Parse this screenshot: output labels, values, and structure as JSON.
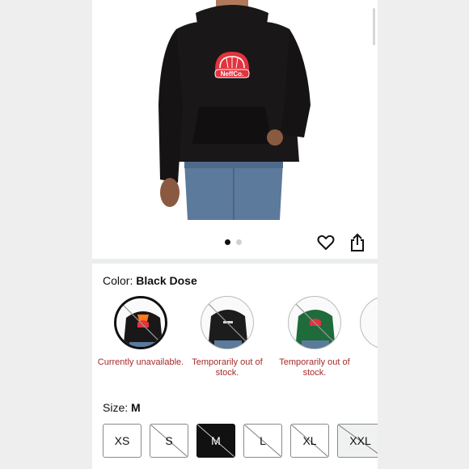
{
  "product": {
    "logo_text": "NeffCo."
  },
  "gallery": {
    "dots": [
      true,
      false
    ]
  },
  "color": {
    "label": "Color:",
    "selected": "Black Dose",
    "swatches": [
      {
        "color": "#1a1719",
        "status": "Currently unavailable.",
        "selected": true
      },
      {
        "color": "#1c1c1c",
        "status": "Temporarily out of stock.",
        "selected": false
      },
      {
        "color": "#1f6b3b",
        "status": "Temporarily out of stock.",
        "selected": false
      }
    ]
  },
  "size": {
    "label": "Size:",
    "selected": "M",
    "options": [
      {
        "label": "XS",
        "state": "available"
      },
      {
        "label": "S",
        "state": "unavailable"
      },
      {
        "label": "M",
        "state": "selected"
      },
      {
        "label": "L",
        "state": "unavailable"
      },
      {
        "label": "XL",
        "state": "unavailable"
      },
      {
        "label": "XXL",
        "state": "unavailable-gray"
      }
    ]
  },
  "colors": {
    "status_red": "#a52a2a",
    "hoodie": "#1a1719",
    "jeans": "#5b7a9c",
    "accent_orange": "#ff7a1a",
    "logo_red": "#e2343e"
  },
  "icons": {
    "wishlist": "heart-icon",
    "share": "share-icon"
  }
}
